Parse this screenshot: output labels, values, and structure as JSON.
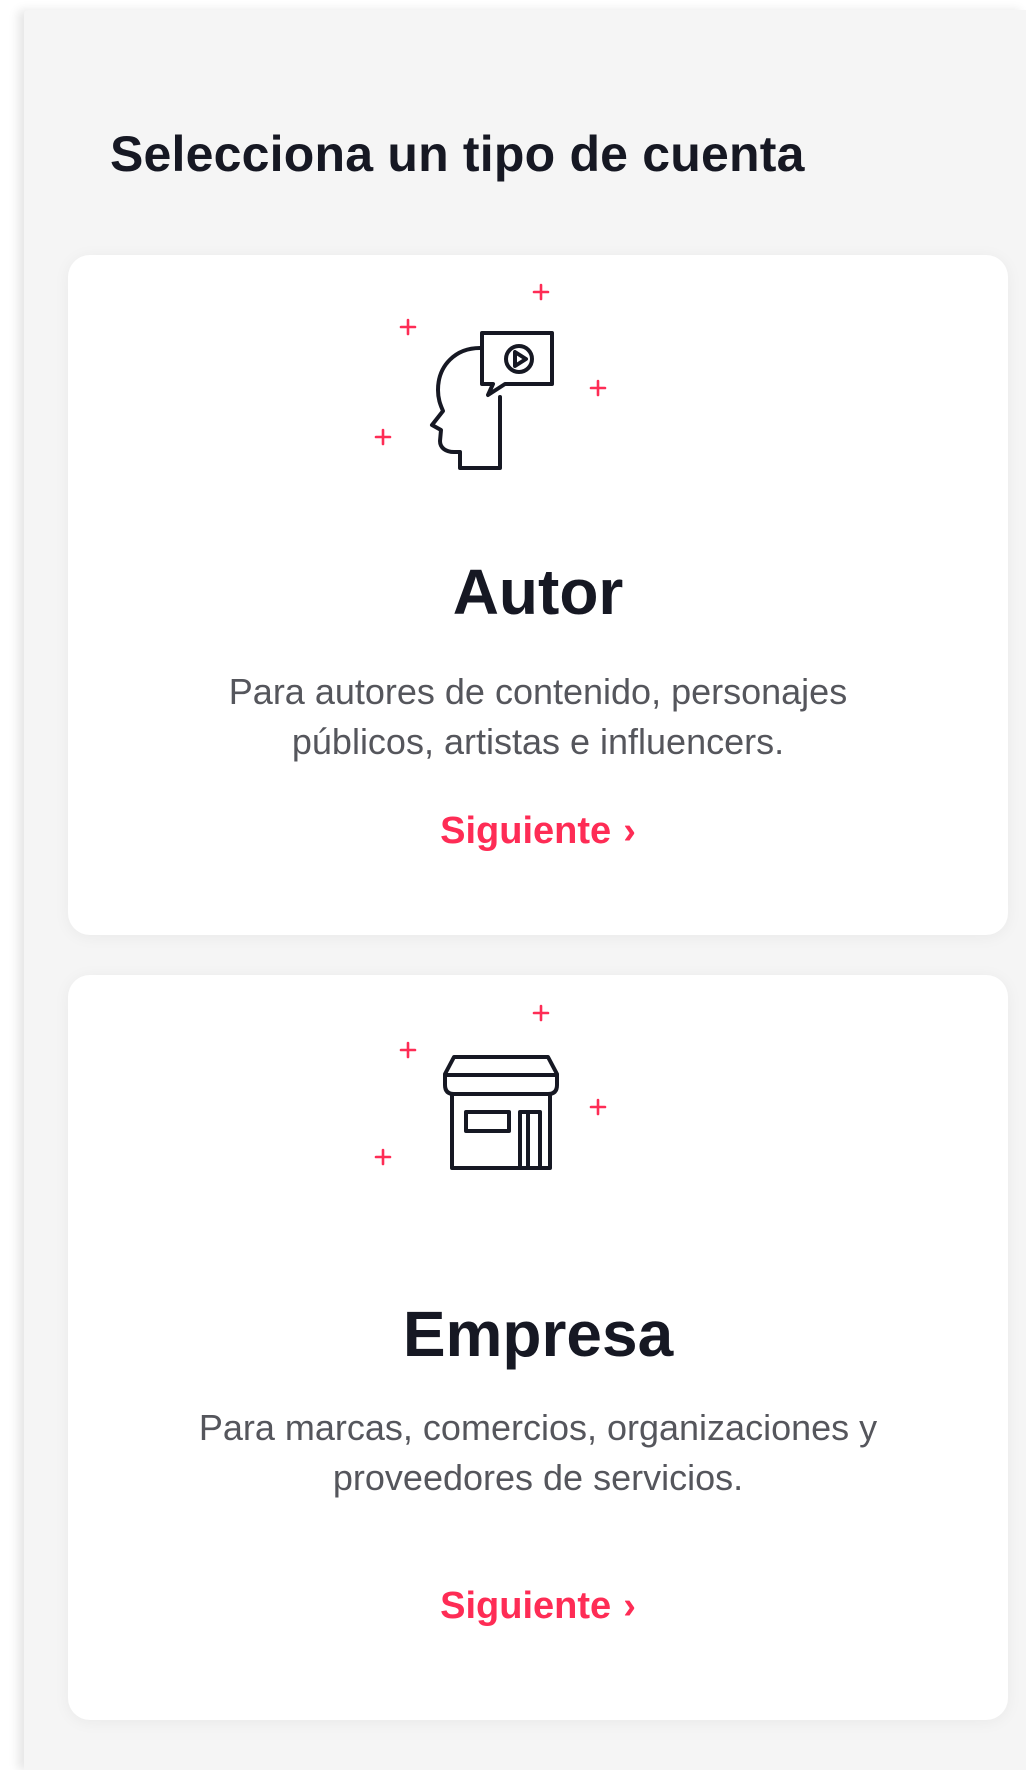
{
  "page": {
    "title": "Selecciona un tipo de cuenta"
  },
  "colors": {
    "accent": "#fe2c55",
    "text_primary": "#161823",
    "text_secondary": "#55565c",
    "background": "#f5f5f5",
    "card": "#ffffff"
  },
  "account_types": [
    {
      "icon": "creator-head-video-icon",
      "title": "Autor",
      "description": "Para autores de contenido, personajes públicos, artistas e influencers.",
      "next_label": "Siguiente",
      "next_icon": "chevron-right-icon",
      "chevron": "›"
    },
    {
      "icon": "storefront-icon",
      "title": "Empresa",
      "description": "Para marcas, comercios, organizaciones y proveedores de servicios.",
      "next_label": "Siguiente",
      "next_icon": "chevron-right-icon",
      "chevron": "›"
    }
  ]
}
